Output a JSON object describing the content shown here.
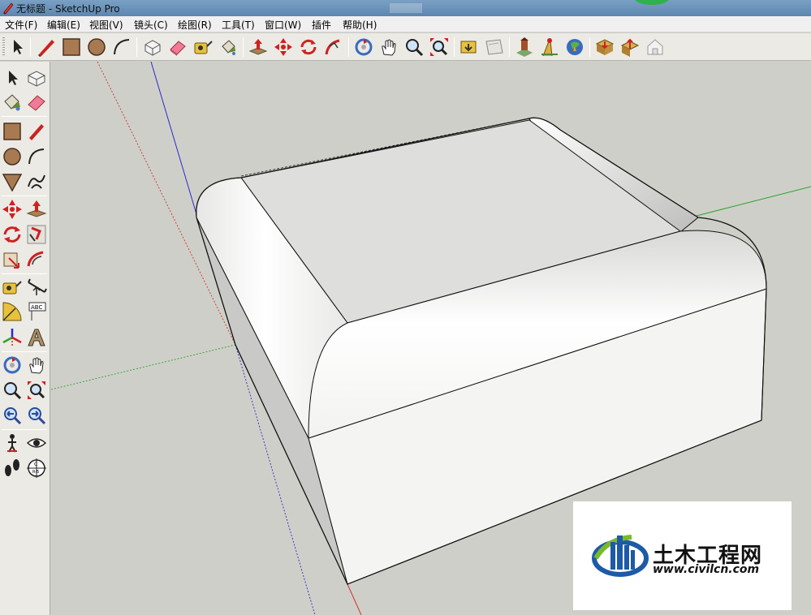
{
  "window": {
    "title": "无标题 - SketchUp Pro"
  },
  "menu": {
    "items": [
      "文件(F)",
      "编辑(E)",
      "视图(V)",
      "镜头(C)",
      "绘图(R)",
      "工具(T)",
      "窗口(W)",
      "插件",
      "帮助(H)"
    ]
  },
  "toolbar": {
    "tools": [
      "select",
      "line",
      "rectangle",
      "circle",
      "arc",
      "make-component",
      "eraser",
      "tape-measure",
      "paint-bucket",
      "push-pull",
      "move",
      "rotate",
      "follow-me",
      "orbit",
      "pan",
      "zoom",
      "zoom-extents",
      "get-models",
      "share-model",
      "add-location",
      "toggle-terrain",
      "photo-textures",
      "get-models-warehouse",
      "share-component",
      "preview-google-earth"
    ]
  },
  "sidebar": {
    "tools": [
      "select",
      "make-component",
      "paint-bucket",
      "eraser",
      "rectangle",
      "line",
      "circle",
      "arc",
      "polygon",
      "freehand",
      "move",
      "push-pull",
      "rotate",
      "follow-me",
      "scale",
      "offset",
      "tape-measure",
      "dimension",
      "protractor",
      "text",
      "axes",
      "3d-text",
      "orbit",
      "pan",
      "zoom",
      "zoom-window",
      "previous",
      "zoom-extents",
      "position-camera",
      "look-around",
      "walk",
      "section-plane"
    ]
  },
  "watermark": {
    "title": "土木工程网",
    "url": "www.civilcn.com"
  },
  "colors": {
    "background": "#cfcfc9",
    "axis_red": "#d23030",
    "axis_green": "#2aa52a",
    "axis_blue": "#2a2ad0",
    "logo_blue": "#1d5aa8",
    "logo_green": "#7ab928"
  }
}
